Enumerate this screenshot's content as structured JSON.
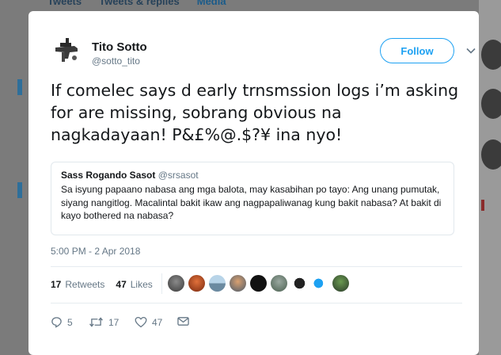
{
  "background": {
    "tabs": [
      "Tweets",
      "Tweets & replies",
      "Media"
    ]
  },
  "tweet": {
    "author_name": "Tito Sotto",
    "author_handle": "@sotto_tito",
    "follow_label": "Follow",
    "text": "If comelec says d early trnsmssion logs i’m asking for are missing, sobrang obvious na nagkadayaan! P&£%@.$?¥ ina nyo!",
    "timestamp": "5:00 PM - 2 Apr 2018",
    "retweets_count": "17",
    "retweets_label": "Retweets",
    "likes_count": "47",
    "likes_label": "Likes",
    "actions": {
      "reply_count": "5",
      "retweet_count": "17",
      "like_count": "47"
    }
  },
  "quoted_tweet": {
    "author_name": "Sass Rogando Sasot",
    "author_handle": "@srsasot",
    "text": "Sa isyung papaano nabasa ang mga balota, may kasabihan po tayo: Ang unang pumutak, siyang nangitlog. Macalintal bakit ikaw ang nagpapaliwanag kung bakit nabasa? At bakit di kayo bothered na nabasa?"
  },
  "colors": {
    "accent": "#1da1f2",
    "text": "#14171a",
    "muted": "#657786"
  },
  "icons": [
    "reply-icon",
    "retweet-icon",
    "like-icon",
    "message-icon",
    "chevron-down-icon"
  ]
}
